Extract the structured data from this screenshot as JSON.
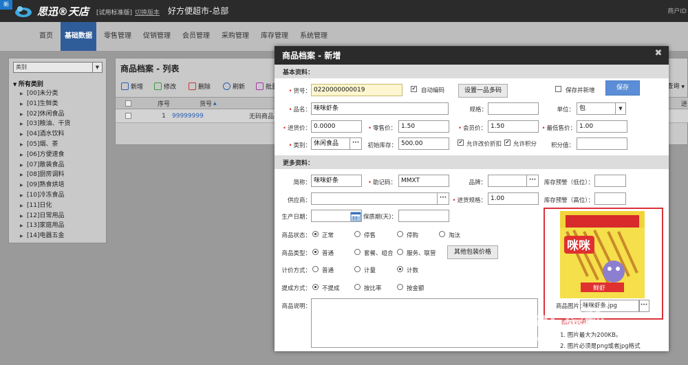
{
  "topbar": {
    "badge": "新",
    "brand": "思迅®天店",
    "edition": "[试用标准版]",
    "switch_version": "切换版本",
    "store": "好方便超市-总部",
    "user": "商户ID"
  },
  "menu": [
    "首页",
    "基础数据",
    "零售管理",
    "促销管理",
    "会员管理",
    "采购管理",
    "库存管理",
    "系统管理"
  ],
  "category_panel": {
    "select_value": "类别",
    "root": "所有类别",
    "items": [
      "[00]未分类",
      "[01]生鲜类",
      "[02]休闲食品",
      "[03]粮油、干货",
      "[04]酒水饮料",
      "[05]烟、茶",
      "[06]方便速食",
      "[07]散装食品",
      "[08]厨房调料",
      "[09]熟食烘培",
      "[10]冷冻食品",
      "[11]日化",
      "[12]日常用品",
      "[13]家庭用品",
      "[14]电器五金"
    ]
  },
  "list_panel": {
    "title": "商品档案 - 列表",
    "toolbar": {
      "add": "新增",
      "edit": "修改",
      "delete": "删除",
      "refresh": "刷新",
      "batch": "批量",
      "search": "查询"
    },
    "columns": {
      "no": "序号",
      "code": "货号",
      "extra": "进"
    },
    "rows": [
      {
        "no": "1",
        "code": "99999999",
        "name": "无码商品"
      }
    ]
  },
  "modal": {
    "title": "商品档案 - 新增",
    "section_basic": "基本资料：",
    "section_more": "更多资料：",
    "labels": {
      "code": "货号：",
      "auto_code": "自动编码",
      "set_multi_code": "设置一品多码",
      "save_and_new": "保存并新增",
      "save": "保存",
      "name": "品名：",
      "spec": "规格：",
      "unit": "单位：",
      "cost": "进货价：",
      "retail": "零售价：",
      "member": "会员价：",
      "min_price": "最低售价：",
      "category": "类别：",
      "initial_stock": "初始库存：",
      "allow_discount": "允许改价折扣",
      "allow_points": "允许积分",
      "points": "积分值：",
      "short_name": "简称：",
      "mnemonic": "助记码：",
      "brand": "品牌：",
      "stock_low": "库存预警（低位）：",
      "supplier": "供应商：",
      "purchase_spec": "进货规格：",
      "stock_high": "库存预警（高位）：",
      "produce_date": "生产日期：",
      "shelf_life": "保质期(天)：",
      "status": "商品状态：",
      "type": "商品类型：",
      "pricing": "计价方式：",
      "commission": "提成方式：",
      "other_pack_price": "其他包装价格",
      "description": "商品说明：",
      "product_image": "商品图片："
    },
    "values": {
      "code": "0220000000019",
      "name": "咪咪虾条",
      "spec": "",
      "unit": "包",
      "cost": "0.0000",
      "retail": "1.50",
      "member": "1.50",
      "min_price": "1.00",
      "category": "休闲食品",
      "initial_stock": "500.00",
      "points": "",
      "short_name": "咪咪虾条",
      "mnemonic": "MMXT",
      "brand": "",
      "stock_low": "",
      "supplier": "",
      "purchase_spec": "1.00",
      "stock_high": "",
      "produce_date": "",
      "shelf_life": "",
      "image_file": "咪咪虾条.jpg"
    },
    "status_options": [
      "正常",
      "停售",
      "停购",
      "淘汰"
    ],
    "type_options": [
      "普通",
      "套餐、组合",
      "服务、联营"
    ],
    "pricing_options": [
      "普通",
      "计量",
      "计数"
    ],
    "commission_options": [
      "不提成",
      "按比率",
      "按金额"
    ],
    "image_notes": {
      "title": "图片说明：",
      "line1": "1. 图片最大为200KB。",
      "line2": "2. 图片必须是png或者jpg格式"
    }
  },
  "image_text": {
    "big": "咪咪",
    "small": "鲜虾"
  },
  "watermark": {
    "main": "Bai 经验",
    "sub": "jingyan.baidu.com"
  },
  "colors": {
    "menu_active": "#2f5d9a",
    "save_button": "#5b8ed6",
    "highlight_border": "#d9313a",
    "link": "#2a5fb0"
  }
}
